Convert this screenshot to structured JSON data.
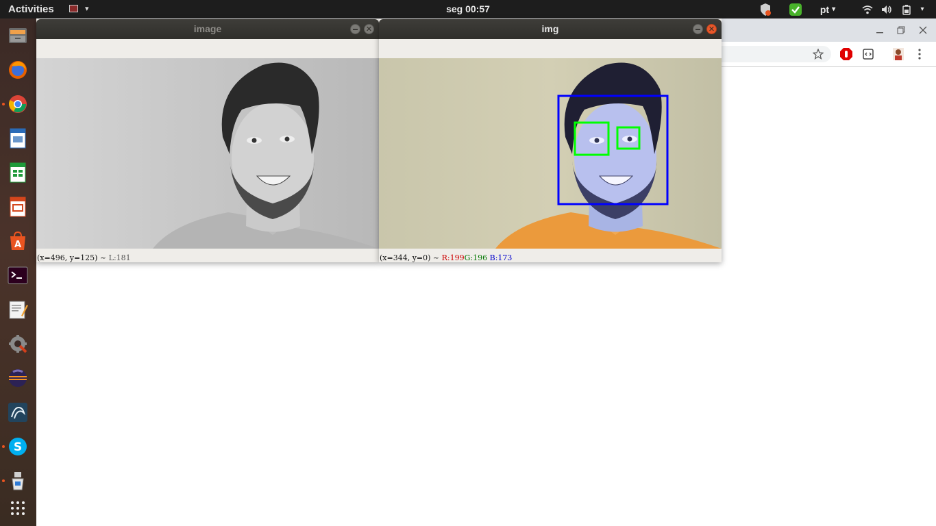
{
  "topbar": {
    "activities": "Activities",
    "clock": "seg 00:57",
    "language": "pt",
    "caret": "▾",
    "tray_icons": [
      "shield-notification-icon",
      "check-icon",
      "wifi-icon",
      "volume-icon",
      "battery-icon"
    ]
  },
  "dock": {
    "items": [
      "files-icon",
      "firefox-icon",
      "chrome-icon",
      "writer-icon",
      "calc-icon",
      "impress-icon",
      "software-center-icon",
      "terminal-icon",
      "text-editor-icon",
      "settings-icon",
      "eclipse-icon",
      "mysql-workbench-icon",
      "skype-icon",
      "cleaner-icon",
      "show-apps-icon"
    ]
  },
  "window_gray": {
    "title": "image",
    "status": "(x=496, y=125) ~",
    "status_value": "L:181"
  },
  "window_color": {
    "title": "img",
    "status": "(x=344, y=0) ~",
    "r": "R:199",
    "g": "G:196",
    "b": "B:173"
  },
  "colors": {
    "accent": "#e95420",
    "face_box": "#0000ff",
    "eye_box": "#00ff00",
    "r_text": "#cc0000",
    "g_text": "#007700",
    "b_text": "#0000cc"
  }
}
